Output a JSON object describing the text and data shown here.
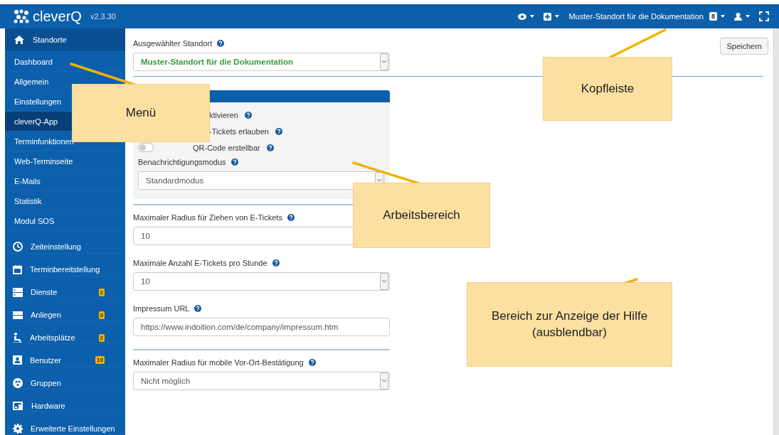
{
  "header": {
    "logo": "cleverQ",
    "version": "v2.3.30",
    "location": "Muster-Standort für die Dokumentation",
    "badge": "8"
  },
  "sidebar": {
    "items": [
      {
        "kind": "section",
        "label": "Standorte",
        "selected": false
      },
      {
        "kind": "sub",
        "label": "Dashboard",
        "selected": false
      },
      {
        "kind": "sub",
        "label": "Allgemein",
        "selected": false
      },
      {
        "kind": "sub",
        "label": "Einstellungen",
        "selected": false
      },
      {
        "kind": "sub",
        "label": "cleverQ-App",
        "selected": true
      },
      {
        "kind": "sub",
        "label": "Terminfunktionen",
        "selected": false
      },
      {
        "kind": "sub",
        "label": "Web-Terminseite",
        "selected": false
      },
      {
        "kind": "sub",
        "label": "E-Mails",
        "selected": false
      },
      {
        "kind": "sub",
        "label": "Statistik",
        "selected": false
      },
      {
        "kind": "sub",
        "label": "Modul SOS",
        "selected": false
      },
      {
        "kind": "main",
        "label": "Zeiteinstellung",
        "selected": false
      },
      {
        "kind": "main",
        "label": "Terminbereitstellung",
        "selected": false
      },
      {
        "kind": "main",
        "label": "Dienste",
        "badge": "2",
        "selected": false
      },
      {
        "kind": "main",
        "label": "Anliegen",
        "badge": "3",
        "selected": false
      },
      {
        "kind": "main",
        "label": "Arbeitsplätze",
        "badge": "2",
        "selected": false
      },
      {
        "kind": "main",
        "label": "Benutzer",
        "badge": "19",
        "selected": false
      },
      {
        "kind": "main",
        "label": "Gruppen",
        "selected": false
      },
      {
        "kind": "main",
        "label": "Hardware",
        "selected": false
      },
      {
        "kind": "main",
        "label": "Erweiterte Einstellungen",
        "selected": false
      }
    ]
  },
  "location_select": {
    "label": "Ausgewählter Standort",
    "value": "Muster-Standort für die Dokumentation"
  },
  "save_button": "Speichern",
  "app_card": {
    "toggles": [
      {
        "label": "ktivieren"
      },
      {
        "label": "-Tickets erlauben"
      },
      {
        "label": "QR-Code erstellbar",
        "on": false
      }
    ],
    "mode_label": "Benachrichtigungsmodus",
    "mode_value": "Standardmodus"
  },
  "fields": [
    {
      "kind": "input",
      "label": "Maximaler Radius für Ziehen von E-Tickets",
      "value": "10"
    },
    {
      "kind": "select",
      "label": "Maximale Anzahl E-Tickets pro Stunde",
      "value": "10"
    },
    {
      "kind": "input",
      "label": "Impressum URL",
      "value": "https://www.indoition.com/de/company/impressum.htm"
    },
    {
      "kind": "select",
      "label": "Maximaler Radius für mobile Vor-Ort-Bestätigung",
      "value": "Nicht möglich",
      "rule_before": true
    }
  ],
  "callouts": [
    {
      "text": "Menü"
    },
    {
      "text": "Kopfleiste"
    },
    {
      "text": "Arbeitsbereich"
    },
    {
      "text": "Bereich zur Anzeige der Hilfe (ausblendbar)"
    }
  ]
}
